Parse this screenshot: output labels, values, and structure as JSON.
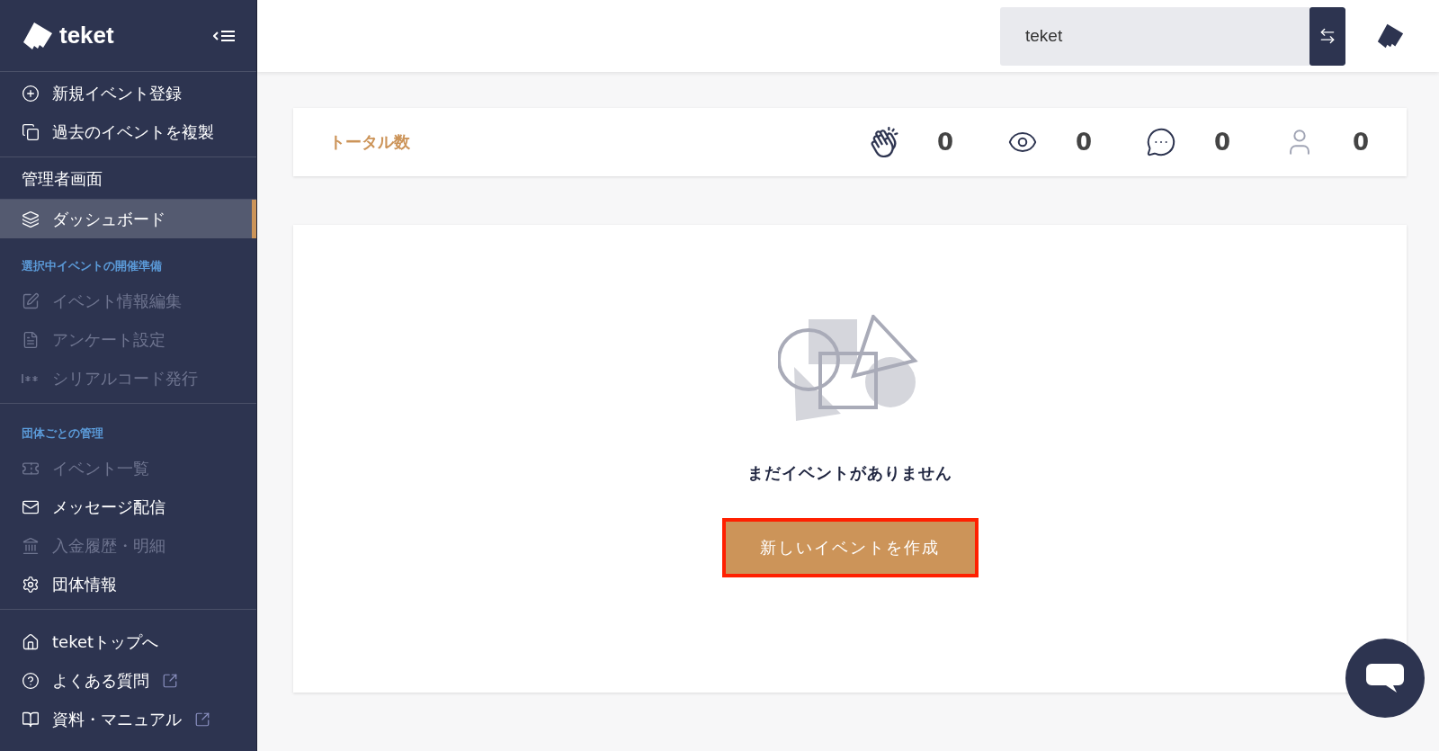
{
  "sidebar": {
    "logo": "teket",
    "groups": [
      {
        "items": [
          {
            "kind": "item",
            "label": "新規イベント登録",
            "disabled": false,
            "selected": false
          },
          {
            "kind": "item",
            "label": "過去のイベントを複製",
            "disabled": false,
            "selected": false
          }
        ]
      },
      {
        "items": [
          {
            "kind": "heading",
            "label": "管理者画面"
          },
          {
            "kind": "item",
            "label": "ダッシュボード",
            "disabled": false,
            "selected": true
          },
          {
            "kind": "section",
            "label": "選択中イベントの開催準備"
          },
          {
            "kind": "item",
            "label": "イベント情報編集",
            "disabled": true,
            "selected": false
          },
          {
            "kind": "item",
            "label": "アンケート設定",
            "disabled": true,
            "selected": false
          },
          {
            "kind": "item",
            "label": "シリアルコード発行",
            "disabled": true,
            "selected": false
          }
        ]
      },
      {
        "items": [
          {
            "kind": "section",
            "label": "団体ごとの管理"
          },
          {
            "kind": "item",
            "label": "イベント一覧",
            "disabled": true,
            "selected": false
          },
          {
            "kind": "item",
            "label": "メッセージ配信",
            "disabled": false,
            "selected": false
          },
          {
            "kind": "item",
            "label": "入金履歴・明細",
            "disabled": true,
            "selected": false
          },
          {
            "kind": "item",
            "label": "団体情報",
            "disabled": false,
            "selected": false
          }
        ]
      },
      {
        "items": [
          {
            "kind": "item",
            "label": "teketトップへ",
            "disabled": false,
            "selected": false,
            "external": false
          },
          {
            "kind": "item",
            "label": "よくある質問",
            "disabled": false,
            "selected": false,
            "external": true
          },
          {
            "kind": "item",
            "label": "資料・マニュアル",
            "disabled": false,
            "selected": false,
            "external": true
          }
        ]
      }
    ]
  },
  "header": {
    "organization": {
      "value": "teket"
    }
  },
  "totals": {
    "label": "トータル数",
    "stats": [
      {
        "value": "0"
      },
      {
        "value": "0"
      },
      {
        "value": "0"
      },
      {
        "value": "0"
      }
    ]
  },
  "empty_state": {
    "message": "まだイベントがありません",
    "button": {
      "label": "新しいイベントを作成",
      "highlighted": true
    }
  }
}
